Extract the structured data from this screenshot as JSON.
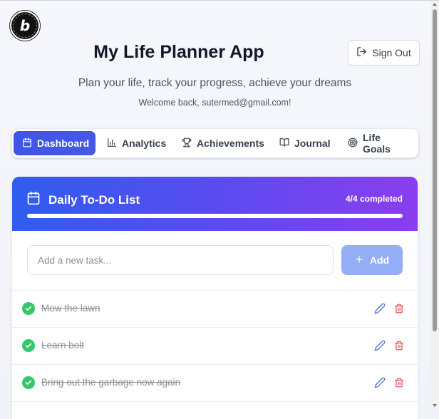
{
  "header": {
    "title": "My Life Planner App",
    "subtitle": "Plan your life, track your progress, achieve your dreams",
    "welcome": "Welcome back, sutermed@gmail.com!",
    "signout_label": "Sign Out"
  },
  "badge": {
    "letter": "b",
    "ring_text": "POWERED BY BOLT"
  },
  "tabs": [
    {
      "label": "Dashboard",
      "icon": "calendar-icon",
      "active": true
    },
    {
      "label": "Analytics",
      "icon": "bar-chart-icon",
      "active": false
    },
    {
      "label": "Achievements",
      "icon": "trophy-icon",
      "active": false
    },
    {
      "label": "Journal",
      "icon": "book-open-icon",
      "active": false
    },
    {
      "label": "Life Goals",
      "icon": "target-icon",
      "active": false
    }
  ],
  "todo": {
    "title": "Daily To-Do List",
    "completed_text": "4/4 completed",
    "progress": 1.0,
    "input_placeholder": "Add a new task...",
    "add_label": "Add",
    "tasks": [
      {
        "text": "Mow the lawn",
        "done": true
      },
      {
        "text": "Learn bolt",
        "done": true
      },
      {
        "text": "Bring out the garbage now again",
        "done": true
      }
    ]
  },
  "colors": {
    "accent": "#3f54e6",
    "header_gradient_start": "#2f5df0",
    "header_gradient_end": "#8b3df0",
    "check_green": "#34c76b",
    "edit_blue": "#4f6fe0",
    "delete_red": "#e04848",
    "add_button": "#93aef5"
  }
}
